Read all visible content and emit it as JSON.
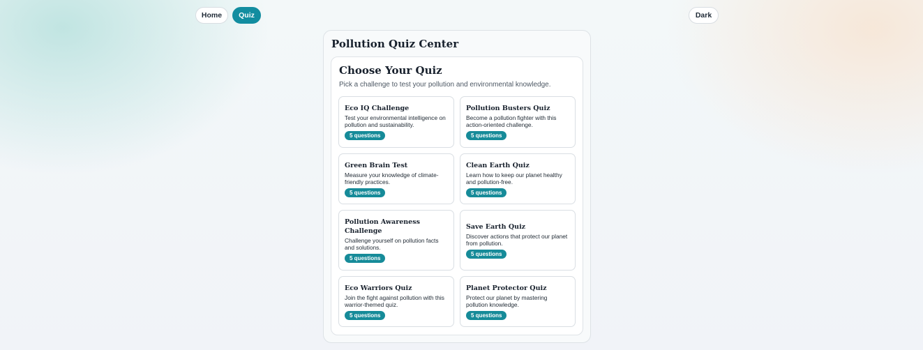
{
  "nav": {
    "home_label": "Home",
    "quiz_label": "Quiz",
    "theme_toggle_label": "Dark"
  },
  "panel": {
    "title": "Pollution Quiz Center"
  },
  "section": {
    "title": "Choose Your Quiz",
    "subtitle": "Pick a challenge to test your pollution and environmental knowledge."
  },
  "quizzes": [
    {
      "title": "Eco IQ Challenge",
      "description": "Test your environmental intelligence on pollution and sustainability.",
      "badge": "5 questions"
    },
    {
      "title": "Pollution Busters Quiz",
      "description": "Become a pollution fighter with this action-oriented challenge.",
      "badge": "5 questions"
    },
    {
      "title": "Green Brain Test",
      "description": "Measure your knowledge of climate-friendly practices.",
      "badge": "5 questions"
    },
    {
      "title": "Clean Earth Quiz",
      "description": "Learn how to keep our planet healthy and pollution-free.",
      "badge": "5 questions"
    },
    {
      "title": "Pollution Awareness Challenge",
      "description": "Challenge yourself on pollution facts and solutions.",
      "badge": "5 questions"
    },
    {
      "title": "Save Earth Quiz",
      "description": "Discover actions that protect our planet from pollution.",
      "badge": "5 questions"
    },
    {
      "title": "Eco Warriors Quiz",
      "description": "Join the fight against pollution with this warrior-themed quiz.",
      "badge": "5 questions"
    },
    {
      "title": "Planet Protector Quiz",
      "description": "Protect our planet by mastering pollution knowledge.",
      "badge": "5 questions"
    }
  ],
  "colors": {
    "accent": "#128da0",
    "badge": "#168b99",
    "text": "#17202c"
  }
}
